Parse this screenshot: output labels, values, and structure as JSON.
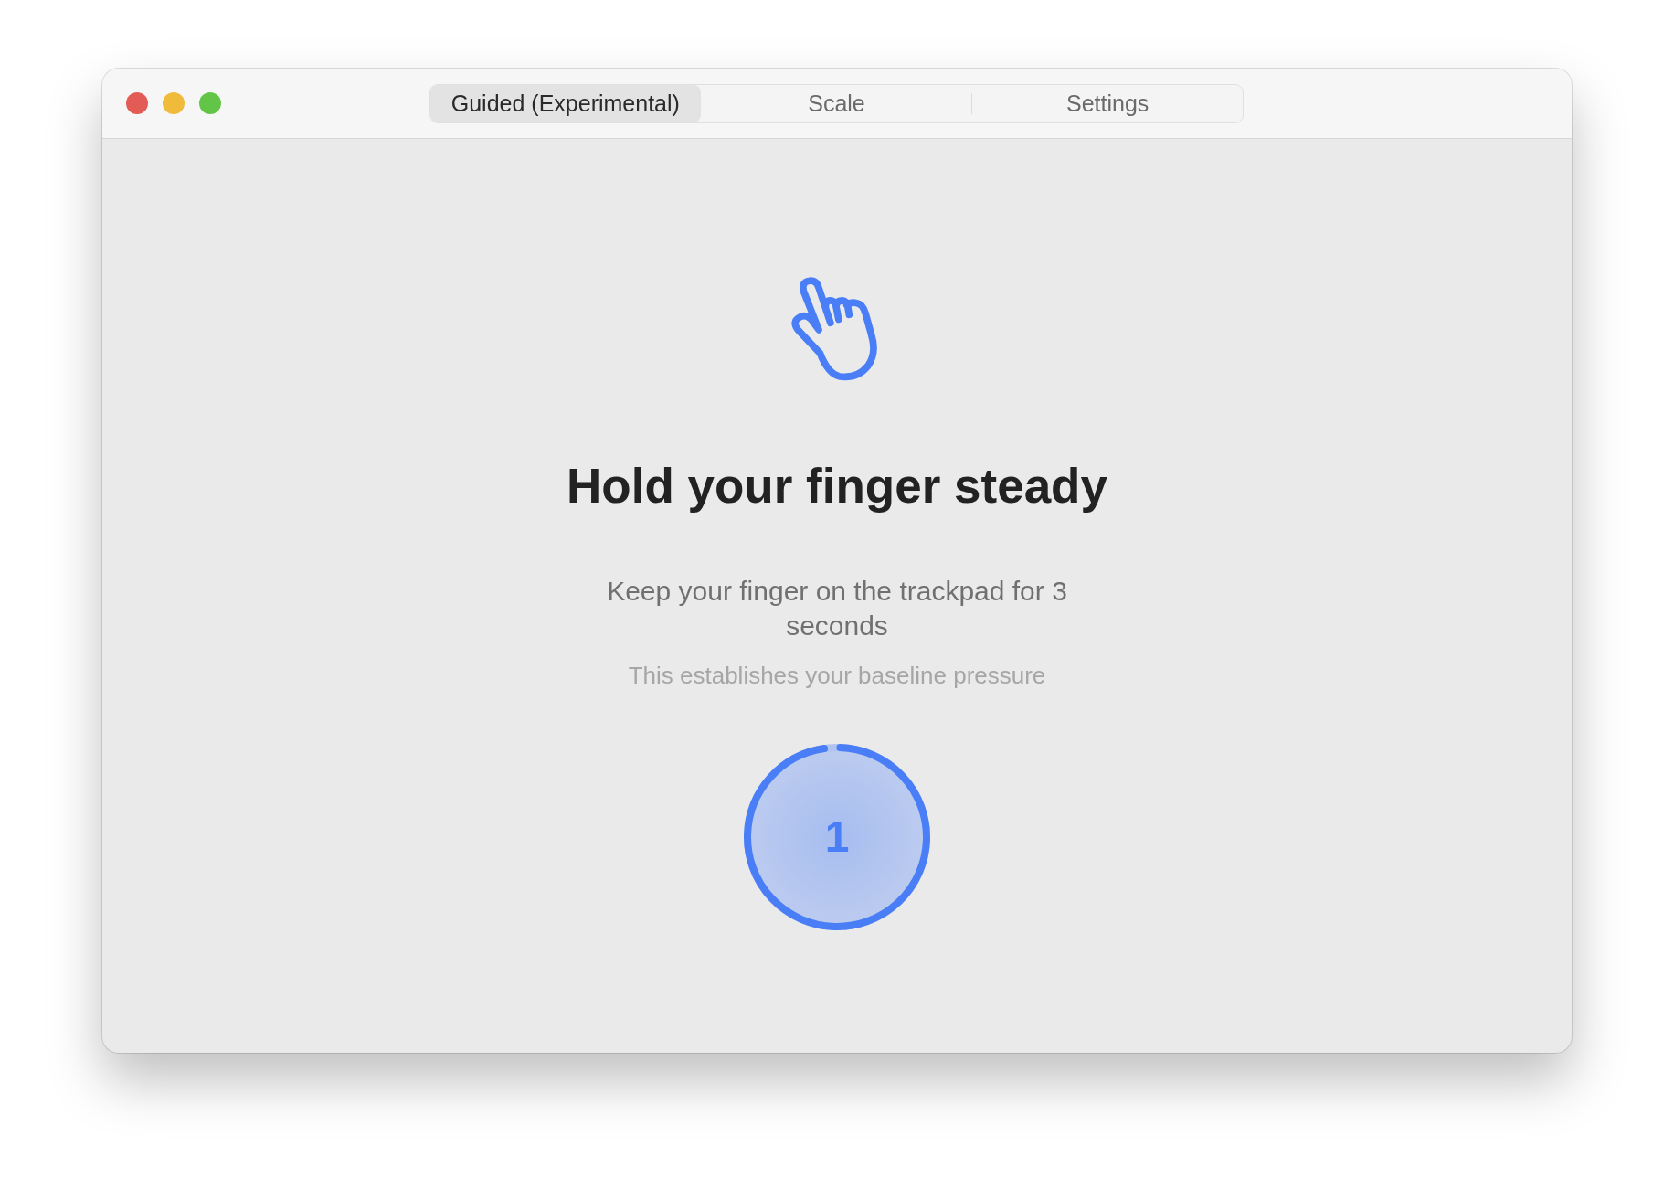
{
  "tabs": [
    {
      "label": "Guided (Experimental)",
      "selected": true
    },
    {
      "label": "Scale",
      "selected": false
    },
    {
      "label": "Settings",
      "selected": false
    }
  ],
  "heading": "Hold your finger steady",
  "instruction": "Keep your finger on the trackpad for 3 seconds",
  "hint": "This establishes your baseline pressure",
  "countdown": {
    "value": "1",
    "level": 0.97
  }
}
